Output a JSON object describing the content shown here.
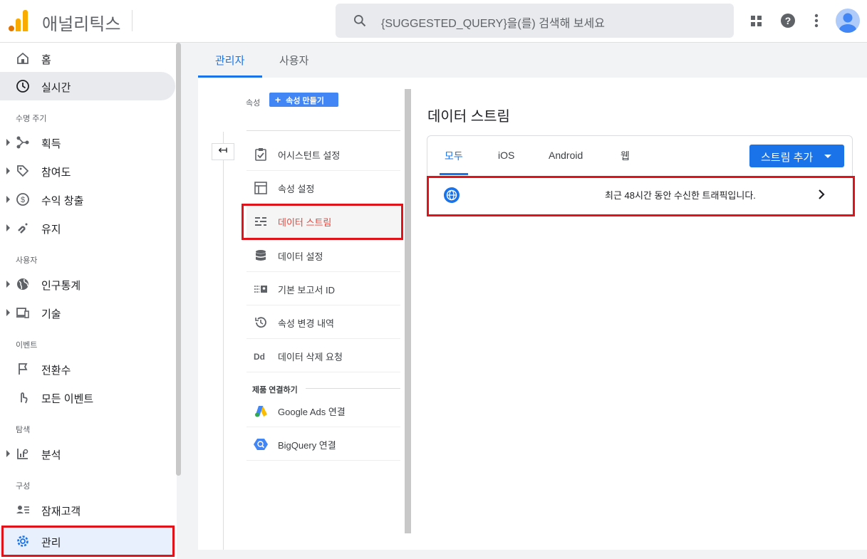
{
  "topbar": {
    "app_title": "애널리틱스",
    "search_placeholder": "{SUGGESTED_QUERY}을(를) 검색해 보세요"
  },
  "leftnav": {
    "home": "홈",
    "realtime": "실시간",
    "section_lifecycle": "수명 주기",
    "acquisition": "획득",
    "engagement": "참여도",
    "monetization": "수익 창출",
    "retention": "유지",
    "section_user": "사용자",
    "demographics": "인구통계",
    "tech": "기술",
    "section_events": "이벤트",
    "conversions": "전환수",
    "all_events": "모든 이벤트",
    "section_explore": "탐색",
    "analysis": "분석",
    "section_configure": "구성",
    "audiences": "잠재고객",
    "admin": "관리"
  },
  "main": {
    "tabs": [
      "관리자",
      "사용자"
    ],
    "property_label": "속성",
    "create_property": "속성 만들기",
    "menu": [
      "어시스턴트 설정",
      "속성 설정",
      "데이터 스트림",
      "데이터 설정",
      "기본 보고서 ID",
      "속성 변경 내역",
      "데이터 삭제 요청"
    ],
    "product_links_label": "제품 연결하기",
    "links": [
      "Google Ads 연결",
      "BigQuery 연결"
    ],
    "collapse_symbol": "↤"
  },
  "data_streams": {
    "title": "데이터 스트림",
    "tabs": [
      "모두",
      "iOS",
      "Android",
      "웹"
    ],
    "add_button": "스트림 추가",
    "row_text": "최근 48시간 동안 수신한 트래픽입니다."
  },
  "colors": {
    "accent": "#1a73e8",
    "highlight_border": "#e0121a",
    "selected_text": "#e8453c"
  }
}
